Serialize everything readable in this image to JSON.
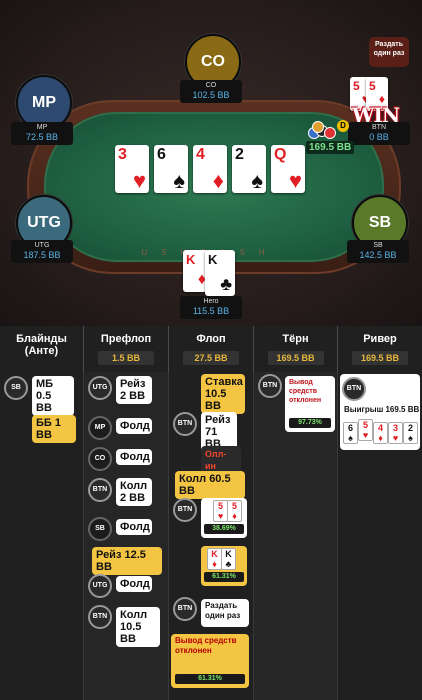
{
  "table": {
    "rail_text": "USHCASH",
    "deal_once_button": "Раздать один раз",
    "win_badge": "WIN",
    "pot": "169.5 BB",
    "dealer_button": "D"
  },
  "seats": [
    {
      "id": "CO",
      "name": "CO",
      "stack": "102.5 BB"
    },
    {
      "id": "MP",
      "name": "MP",
      "stack": "72.5 BB"
    },
    {
      "id": "BTN",
      "name": "BTN",
      "stack": "0 BB"
    },
    {
      "id": "UTG",
      "name": "UTG",
      "stack": "187.5 BB"
    },
    {
      "id": "SB",
      "name": "SB",
      "stack": "142.5 BB"
    },
    {
      "id": "Hero",
      "name": "Hero",
      "stack": "115.5 BB"
    }
  ],
  "btn_hand": [
    {
      "rank": "5",
      "suit": "♥"
    },
    {
      "rank": "5",
      "suit": "♦"
    }
  ],
  "board": [
    {
      "rank": "3",
      "suit": "♥",
      "color": "red"
    },
    {
      "rank": "6",
      "suit": "♠",
      "color": "blk"
    },
    {
      "rank": "4",
      "suit": "♦",
      "color": "red"
    },
    {
      "rank": "2",
      "suit": "♠",
      "color": "blk"
    },
    {
      "rank": "Q",
      "suit": "♥",
      "color": "red"
    }
  ],
  "hero_hand": [
    {
      "rank": "K",
      "suit": "♦",
      "color": "red"
    },
    {
      "rank": "K",
      "suit": "♣",
      "color": "blk"
    }
  ],
  "streets": [
    {
      "name": "Блайнды (Анте)",
      "pot": ""
    },
    {
      "name": "Префлоп",
      "pot": "1.5 BB"
    },
    {
      "name": "Флоп",
      "pot": "27.5 BB"
    },
    {
      "name": "Тёрн",
      "pot": "169.5 BB"
    },
    {
      "name": "Ривер",
      "pot": "169.5 BB"
    }
  ],
  "blinds": {
    "sb_pos": "SB",
    "sb_text": "МБ 0.5 BB",
    "bb_text": "ББ 1 BB"
  },
  "preflop": [
    {
      "pos": "UTG",
      "text": "Рейз 2 BB"
    },
    {
      "pos": "MP",
      "text": "Фолд"
    },
    {
      "pos": "CO",
      "text": "Фолд"
    },
    {
      "pos": "BTN",
      "text": "Колл 2 BB"
    },
    {
      "pos": "SB",
      "text": "Фолд"
    },
    {
      "pos": "",
      "text": "Рейз 12.5 BB"
    },
    {
      "pos": "UTG",
      "text": "Фолд"
    },
    {
      "pos": "BTN",
      "text": "Колл 10.5 BB"
    }
  ],
  "flop": {
    "bet": "Ставка 10.5 BB",
    "btn_pos": "BTN",
    "btn_raise": "Рейз 71 BB",
    "allin": "Олл-ин",
    "call": "Колл 60.5 BB",
    "btn_cards": [
      {
        "rank": "5",
        "suit": "♥"
      },
      {
        "rank": "5",
        "suit": "♦"
      }
    ],
    "btn_pct": "38.69%",
    "hero_cards": [
      {
        "rank": "K",
        "suit": "♦"
      },
      {
        "rank": "K",
        "suit": "♣"
      }
    ],
    "hero_pct": "61.31%",
    "deal_once": "Раздать один раз",
    "cashout": "Вывод средств отклонен",
    "cashout_pct": "61.31%"
  },
  "turn": {
    "pos": "BTN",
    "cashout": "Вывод средств отклонен",
    "pct": "97.73%"
  },
  "river": {
    "pos": "BTN",
    "win": "Выигрыш 169.5 BB",
    "cards": [
      {
        "rank": "6",
        "suit": "♠",
        "color": "blk"
      },
      {
        "rank": "5",
        "suit": "♥",
        "color": "red"
      },
      {
        "rank": "4",
        "suit": "♦",
        "color": "red"
      },
      {
        "rank": "3",
        "suit": "♥",
        "color": "red"
      },
      {
        "rank": "2",
        "suit": "♠",
        "color": "blk"
      }
    ]
  },
  "colors": {
    "accent_blue": "#5bb4ea",
    "pot_green": "#7ee08a",
    "bubble_yellow": "#f4c542",
    "warning_red": "#f2452f"
  }
}
